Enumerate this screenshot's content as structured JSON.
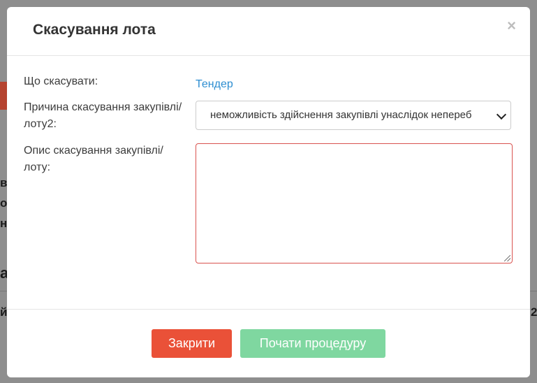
{
  "background": {
    "fragments": [
      "ві",
      "ор",
      "ни",
      "а",
      "й",
      "2",
      "а"
    ]
  },
  "modal": {
    "title": "Скасування лота",
    "close_symbol": "×",
    "fields": {
      "what_label": "Що скасувати:",
      "what_value": "Тендер",
      "reason_label": "Причина скасування закупівлі/лоту2:",
      "reason_value": "неможливість здійснення закупівлі унаслідок непереб",
      "description_label": "Опис скасування закупівлі/лоту:",
      "description_value": ""
    },
    "buttons": {
      "close_label": "Закрити",
      "start_label": "Почати процедуру"
    }
  },
  "colors": {
    "link": "#2d8ed1",
    "danger": "#ea5138",
    "success_disabled": "#7fd7a0",
    "error_border": "#d9534f"
  }
}
